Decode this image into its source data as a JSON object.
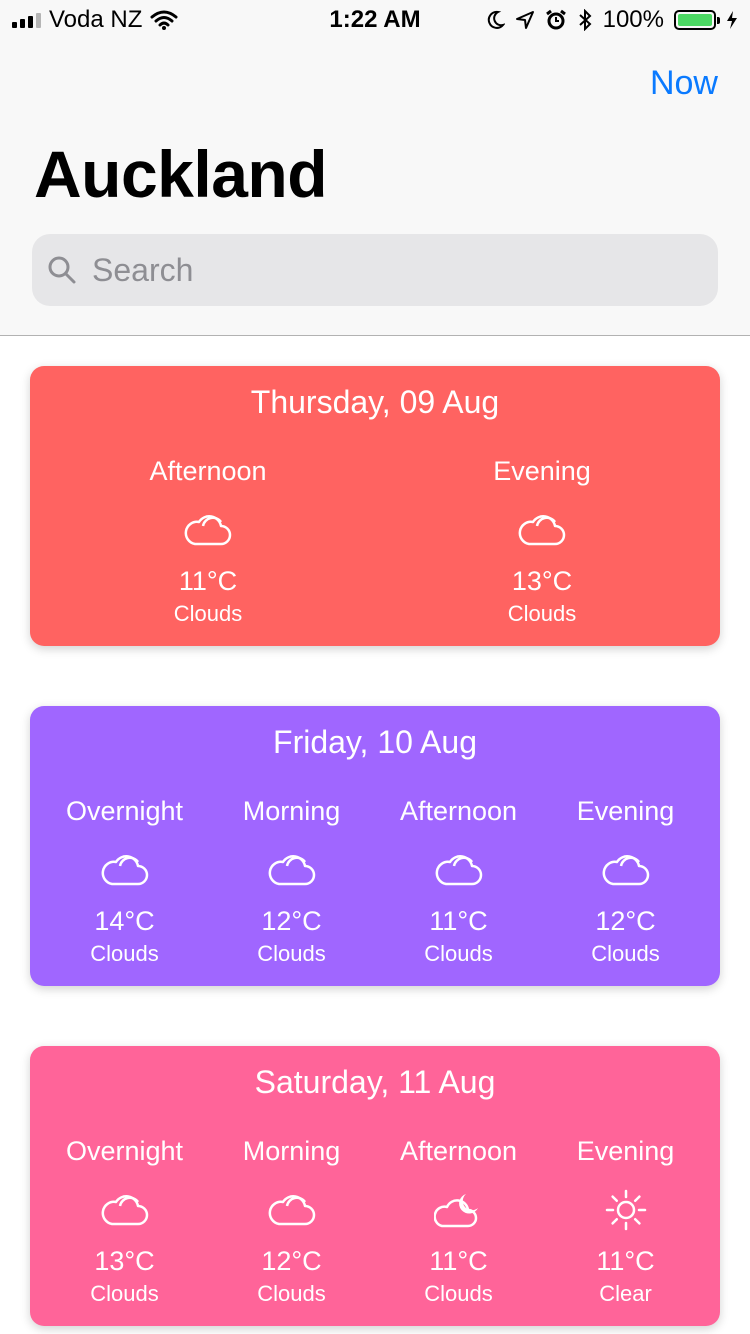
{
  "status_bar": {
    "carrier": "Voda NZ",
    "time": "1:22 AM",
    "battery": "100%",
    "battery_color": "#4cd964"
  },
  "header": {
    "now_label": "Now",
    "title": "Auckland",
    "search_placeholder": "Search",
    "accent": "#0a7aff"
  },
  "days": [
    {
      "date": "Thursday, 09 Aug",
      "color": "#ff6361",
      "periods": [
        {
          "name": "Afternoon",
          "icon": "cloud-icon",
          "temp": "11°C",
          "desc": "Clouds"
        },
        {
          "name": "Evening",
          "icon": "cloud-icon",
          "temp": "13°C",
          "desc": "Clouds"
        }
      ]
    },
    {
      "date": "Friday, 10 Aug",
      "color": "#a066ff",
      "periods": [
        {
          "name": "Overnight",
          "icon": "cloud-icon",
          "temp": "14°C",
          "desc": "Clouds"
        },
        {
          "name": "Morning",
          "icon": "cloud-icon",
          "temp": "12°C",
          "desc": "Clouds"
        },
        {
          "name": "Afternoon",
          "icon": "cloud-icon",
          "temp": "11°C",
          "desc": "Clouds"
        },
        {
          "name": "Evening",
          "icon": "cloud-icon",
          "temp": "12°C",
          "desc": "Clouds"
        }
      ]
    },
    {
      "date": "Saturday, 11 Aug",
      "color": "#ff6499",
      "periods": [
        {
          "name": "Overnight",
          "icon": "cloud-icon",
          "temp": "13°C",
          "desc": "Clouds"
        },
        {
          "name": "Morning",
          "icon": "cloud-icon",
          "temp": "12°C",
          "desc": "Clouds"
        },
        {
          "name": "Afternoon",
          "icon": "cloud-moon-icon",
          "temp": "11°C",
          "desc": "Clouds"
        },
        {
          "name": "Evening",
          "icon": "sun-icon",
          "temp": "11°C",
          "desc": "Clear"
        }
      ]
    }
  ]
}
